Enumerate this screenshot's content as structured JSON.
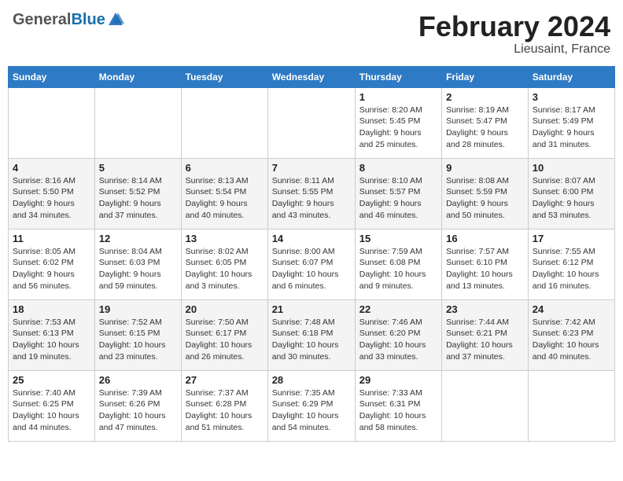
{
  "header": {
    "logo_general": "General",
    "logo_blue": "Blue",
    "month_title": "February 2024",
    "location": "Lieusaint, France"
  },
  "columns": [
    "Sunday",
    "Monday",
    "Tuesday",
    "Wednesday",
    "Thursday",
    "Friday",
    "Saturday"
  ],
  "weeks": [
    [
      {
        "date": "",
        "info": ""
      },
      {
        "date": "",
        "info": ""
      },
      {
        "date": "",
        "info": ""
      },
      {
        "date": "",
        "info": ""
      },
      {
        "date": "1",
        "info": "Sunrise: 8:20 AM\nSunset: 5:45 PM\nDaylight: 9 hours\nand 25 minutes."
      },
      {
        "date": "2",
        "info": "Sunrise: 8:19 AM\nSunset: 5:47 PM\nDaylight: 9 hours\nand 28 minutes."
      },
      {
        "date": "3",
        "info": "Sunrise: 8:17 AM\nSunset: 5:49 PM\nDaylight: 9 hours\nand 31 minutes."
      }
    ],
    [
      {
        "date": "4",
        "info": "Sunrise: 8:16 AM\nSunset: 5:50 PM\nDaylight: 9 hours\nand 34 minutes."
      },
      {
        "date": "5",
        "info": "Sunrise: 8:14 AM\nSunset: 5:52 PM\nDaylight: 9 hours\nand 37 minutes."
      },
      {
        "date": "6",
        "info": "Sunrise: 8:13 AM\nSunset: 5:54 PM\nDaylight: 9 hours\nand 40 minutes."
      },
      {
        "date": "7",
        "info": "Sunrise: 8:11 AM\nSunset: 5:55 PM\nDaylight: 9 hours\nand 43 minutes."
      },
      {
        "date": "8",
        "info": "Sunrise: 8:10 AM\nSunset: 5:57 PM\nDaylight: 9 hours\nand 46 minutes."
      },
      {
        "date": "9",
        "info": "Sunrise: 8:08 AM\nSunset: 5:59 PM\nDaylight: 9 hours\nand 50 minutes."
      },
      {
        "date": "10",
        "info": "Sunrise: 8:07 AM\nSunset: 6:00 PM\nDaylight: 9 hours\nand 53 minutes."
      }
    ],
    [
      {
        "date": "11",
        "info": "Sunrise: 8:05 AM\nSunset: 6:02 PM\nDaylight: 9 hours\nand 56 minutes."
      },
      {
        "date": "12",
        "info": "Sunrise: 8:04 AM\nSunset: 6:03 PM\nDaylight: 9 hours\nand 59 minutes."
      },
      {
        "date": "13",
        "info": "Sunrise: 8:02 AM\nSunset: 6:05 PM\nDaylight: 10 hours\nand 3 minutes."
      },
      {
        "date": "14",
        "info": "Sunrise: 8:00 AM\nSunset: 6:07 PM\nDaylight: 10 hours\nand 6 minutes."
      },
      {
        "date": "15",
        "info": "Sunrise: 7:59 AM\nSunset: 6:08 PM\nDaylight: 10 hours\nand 9 minutes."
      },
      {
        "date": "16",
        "info": "Sunrise: 7:57 AM\nSunset: 6:10 PM\nDaylight: 10 hours\nand 13 minutes."
      },
      {
        "date": "17",
        "info": "Sunrise: 7:55 AM\nSunset: 6:12 PM\nDaylight: 10 hours\nand 16 minutes."
      }
    ],
    [
      {
        "date": "18",
        "info": "Sunrise: 7:53 AM\nSunset: 6:13 PM\nDaylight: 10 hours\nand 19 minutes."
      },
      {
        "date": "19",
        "info": "Sunrise: 7:52 AM\nSunset: 6:15 PM\nDaylight: 10 hours\nand 23 minutes."
      },
      {
        "date": "20",
        "info": "Sunrise: 7:50 AM\nSunset: 6:17 PM\nDaylight: 10 hours\nand 26 minutes."
      },
      {
        "date": "21",
        "info": "Sunrise: 7:48 AM\nSunset: 6:18 PM\nDaylight: 10 hours\nand 30 minutes."
      },
      {
        "date": "22",
        "info": "Sunrise: 7:46 AM\nSunset: 6:20 PM\nDaylight: 10 hours\nand 33 minutes."
      },
      {
        "date": "23",
        "info": "Sunrise: 7:44 AM\nSunset: 6:21 PM\nDaylight: 10 hours\nand 37 minutes."
      },
      {
        "date": "24",
        "info": "Sunrise: 7:42 AM\nSunset: 6:23 PM\nDaylight: 10 hours\nand 40 minutes."
      }
    ],
    [
      {
        "date": "25",
        "info": "Sunrise: 7:40 AM\nSunset: 6:25 PM\nDaylight: 10 hours\nand 44 minutes."
      },
      {
        "date": "26",
        "info": "Sunrise: 7:39 AM\nSunset: 6:26 PM\nDaylight: 10 hours\nand 47 minutes."
      },
      {
        "date": "27",
        "info": "Sunrise: 7:37 AM\nSunset: 6:28 PM\nDaylight: 10 hours\nand 51 minutes."
      },
      {
        "date": "28",
        "info": "Sunrise: 7:35 AM\nSunset: 6:29 PM\nDaylight: 10 hours\nand 54 minutes."
      },
      {
        "date": "29",
        "info": "Sunrise: 7:33 AM\nSunset: 6:31 PM\nDaylight: 10 hours\nand 58 minutes."
      },
      {
        "date": "",
        "info": ""
      },
      {
        "date": "",
        "info": ""
      }
    ]
  ]
}
